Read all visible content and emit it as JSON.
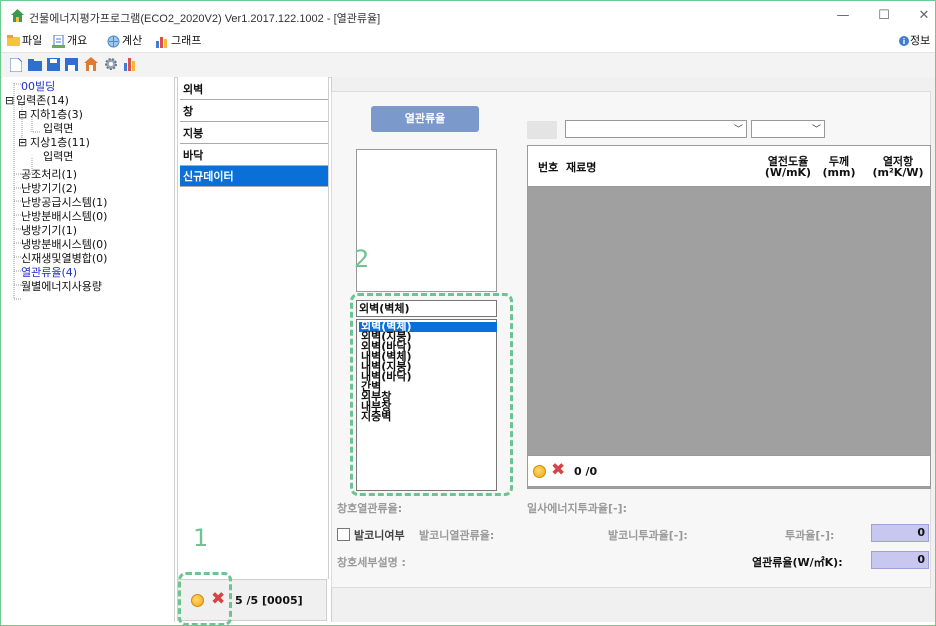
{
  "window": {
    "title": "건물에너지평가프로그램(ECO2_2020V2) Ver1.2017.122.1002 - [열관류율]",
    "controls": [
      "—",
      "☐",
      "✕"
    ]
  },
  "menu": {
    "file": "파일",
    "overview": "개요",
    "calc": "계산",
    "graph": "그래프",
    "info": "정보"
  },
  "tree": {
    "building": "00빌딩",
    "input_zone": "입력존(14)",
    "b1": "지하1층(3)",
    "b1_child": "입력면",
    "f1": "지상1층(11)",
    "f1_child": "입력면",
    "hvac": "공조처리(1)",
    "heater": "난방기기(2)",
    "heat_supply": "난방공급시스템(1)",
    "heat_dist": "난방분배시스템(0)",
    "cooler": "냉방기기(1)",
    "cool_dist": "냉방분배시스템(0)",
    "renewable": "신재생및열병합(0)",
    "u_value": "열관류율(4)",
    "monthly": "월별에너지사용량"
  },
  "categories": [
    "외벽",
    "창",
    "지붕",
    "바닥",
    "신규데이터"
  ],
  "mid_status": "5 /5 [0005]",
  "panel": {
    "tab": "열관류율",
    "dropdown_value": "외벽(벽체)",
    "dropdown_options": [
      "외벽(벽체)",
      "외벽(지붕)",
      "외벽(바닥)",
      "내벽(벽체)",
      "내벽(지붕)",
      "내벽(바닥)",
      "간벽",
      "외부창",
      "내부창",
      "지중벽"
    ],
    "grid_headers": {
      "no": "번호",
      "material": "재료명",
      "conductivity": "열전도율",
      "conductivity_unit": "(W/mK)",
      "thickness": "두께",
      "thickness_unit": "(mm)",
      "resistance": "열저항",
      "resistance_unit": "(m²K/W)"
    },
    "grid_count": "0 /0",
    "window_u": "창호열관류율:",
    "solar": "일사에너지투과율[-]:",
    "balcony_check": "발코니여부",
    "balcony_u": "발코니열관류율:",
    "balcony_trans": "발코니투과율[-]:",
    "transmittance": "투과율[-]:",
    "transmittance_val": "0",
    "window_desc": "창호세부설명 :",
    "u_value": "열관류율(W/㎡K):",
    "u_value_val": "0"
  },
  "annotations": {
    "one": "1",
    "two": "2"
  },
  "colors": {
    "accent": "#0a6fd6",
    "annotation": "#6ec393",
    "tab": "#7c99cc",
    "valuebox": "#c7c7f0"
  }
}
